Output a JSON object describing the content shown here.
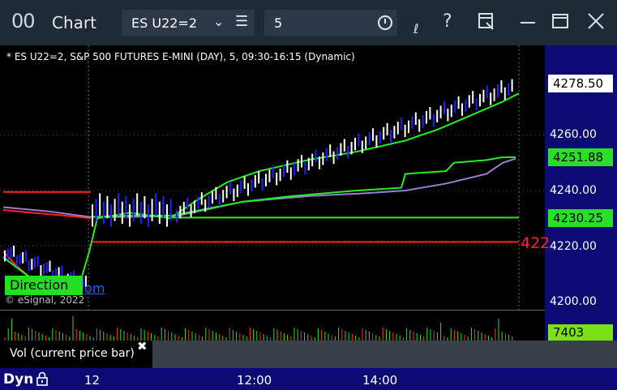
{
  "window": {
    "icon": "00",
    "title": "Chart",
    "symbol": "ES U22=2",
    "interval": "5",
    "icons": [
      "chevron-down-icon",
      "hamburger-menu-icon",
      "clock-icon",
      "drawing-tool-icon",
      "help-icon",
      "page-setup-icon",
      "maximize-icon",
      "close-icon"
    ]
  },
  "chart": {
    "title": "* ES U22=2, S&P 500 FUTURES E-MINI (DAY), 5, 09:30-16:15 (Dynamic)",
    "copyright": "© eSignal, 2022",
    "direction_label": "Direction",
    "direction_link": "om",
    "price_ticks": [
      "4260.00",
      "4240.00",
      "4220.00",
      "4200.00"
    ],
    "last_price": "4278.50",
    "ma_value": "4251.88",
    "level_value": "4230.25",
    "red_level_label": "422",
    "colors": {
      "up_bar": "#ffffff",
      "down_bar": "#2222ff",
      "ma_green": "#22ee22",
      "ma_purple": "#9a7fd0",
      "level_red": "#ff2222",
      "axis_blue": "#0b0b73"
    }
  },
  "volume": {
    "label": "Vol (current price bar)",
    "value": "7403",
    "close_glyph": "✖"
  },
  "time_axis": {
    "mode": "Dyn",
    "labels": [
      "12",
      "12:00",
      "14:00"
    ]
  }
}
